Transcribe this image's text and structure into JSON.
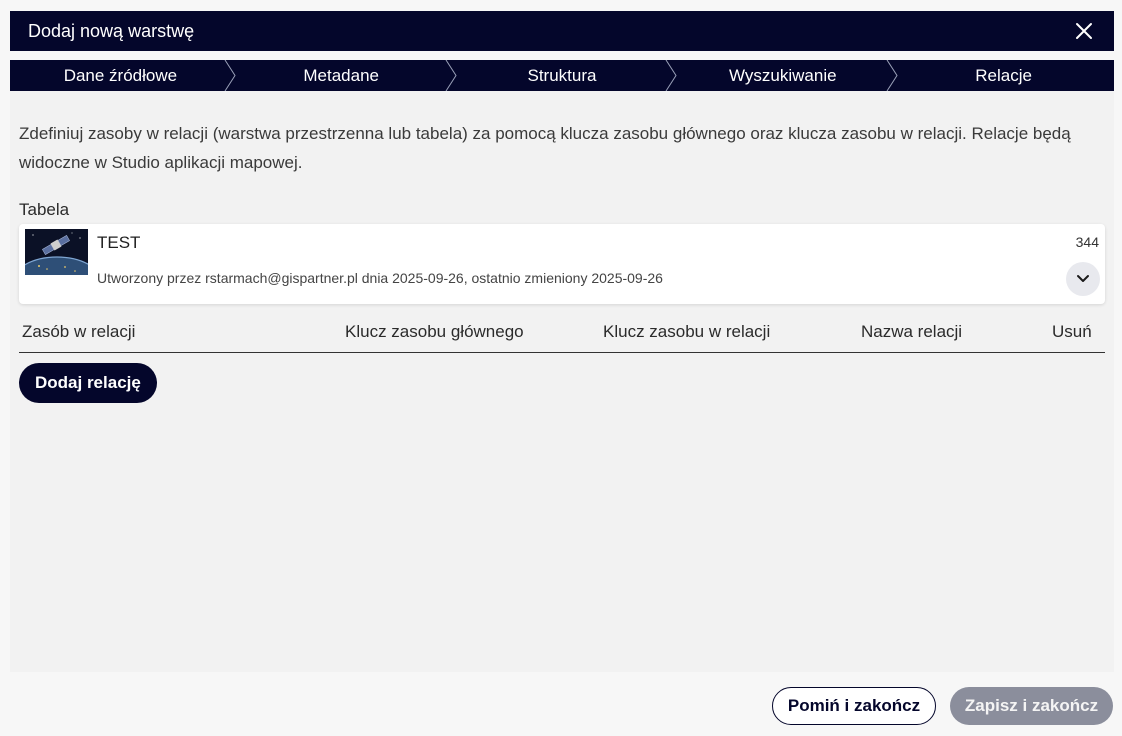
{
  "dialog": {
    "title": "Dodaj nową warstwę"
  },
  "steps": [
    {
      "label": "Dane źródłowe"
    },
    {
      "label": "Metadane"
    },
    {
      "label": "Struktura"
    },
    {
      "label": "Wyszukiwanie"
    },
    {
      "label": "Relacje"
    }
  ],
  "content": {
    "description": "Zdefiniuj zasoby w relacji (warstwa przestrzenna lub tabela) za pomocą klucza zasobu głównego oraz klucza zasobu w relacji. Relacje będą widoczne w Studio aplikacji mapowej.",
    "table_label": "Tabela",
    "table_card": {
      "title": "TEST",
      "meta": "Utworzony przez rstarmach@gispartner.pl dnia 2025-09-26, ostatnio zmieniony 2025-09-26",
      "count": "344"
    },
    "relations_columns": [
      "Zasób w relacji",
      "Klucz zasobu głównego",
      "Klucz zasobu w relacji",
      "Nazwa relacji",
      "Usuń"
    ],
    "add_relation_label": "Dodaj relację"
  },
  "footer": {
    "skip_label": "Pomiń i zakończ",
    "save_label": "Zapisz i zakończ"
  },
  "colors": {
    "primary": "#04062b",
    "disabled_button": "#8b8e9c"
  }
}
